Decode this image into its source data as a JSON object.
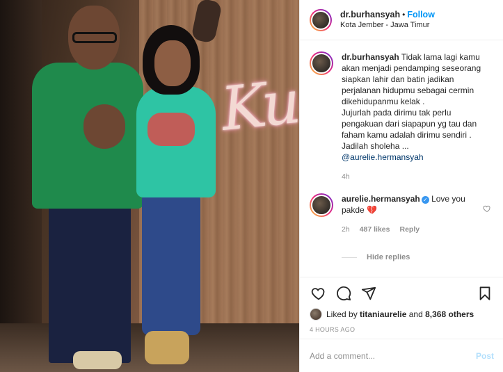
{
  "post": {
    "username": "dr.burhansyah",
    "separator": "•",
    "follow_label": "Follow",
    "location": "Kota Jember - Jawa Timur",
    "photo_sign_text": "Kue"
  },
  "caption": {
    "username": "dr.burhansyah",
    "lines": [
      "Tidak lama lagi kamu",
      "akan menjadi pendamping seseorang",
      "siapkan lahir dan batin jadikan",
      "perjalanan hidupmu sebagai cermin",
      "dikehidupanmu kelak .",
      "Jujurlah pada dirimu tak perlu",
      "pengakuan dari siapapun yg tau dan",
      "faham kamu adalah dirimu sendiri .",
      "Jadilah sholeha ..."
    ],
    "mention": "@aurelie.hermansyah",
    "time": "4h"
  },
  "reply": {
    "username": "aurelie.hermansyah",
    "verified_glyph": "✓",
    "text": "Love you",
    "text2": "pakde",
    "emoji": "💔",
    "time": "2h",
    "likes": "487 likes",
    "reply_label": "Reply",
    "hide_replies_label": "Hide replies"
  },
  "likes": {
    "prefix": "Liked by",
    "user": "titaniaurelie",
    "middle": "and",
    "others": "8,368 others"
  },
  "timestamp": "4 HOURS AGO",
  "comment_box": {
    "placeholder": "Add a comment...",
    "post_label": "Post"
  },
  "colors": {
    "accent": "#0095f6",
    "post_disabled": "#b2dffc",
    "muted": "#8e8e8e"
  },
  "icons": [
    "heart-icon",
    "comment-icon",
    "share-icon",
    "bookmark-icon",
    "heart-outline-small-icon",
    "verified-badge-icon"
  ]
}
